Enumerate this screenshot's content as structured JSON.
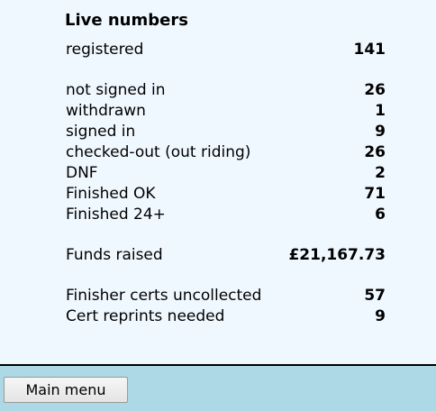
{
  "live": {
    "title": "Live numbers",
    "registered": {
      "label": "registered",
      "value": "141"
    },
    "not_signed_in": {
      "label": "not signed in",
      "value": "26"
    },
    "withdrawn": {
      "label": "withdrawn",
      "value": "1"
    },
    "signed_in": {
      "label": "signed in",
      "value": "9"
    },
    "checked_out": {
      "label": "checked-out (out riding)",
      "value": "26"
    },
    "dnf": {
      "label": "DNF",
      "value": "2"
    },
    "finished_ok": {
      "label": "Finished OK",
      "value": "71"
    },
    "finished_24": {
      "label": "Finished 24+",
      "value": "6"
    },
    "funds": {
      "label": "Funds raised",
      "value": "£21,167.73"
    },
    "certs_uncollected": {
      "label": "Finisher certs uncollected",
      "value": "57"
    },
    "cert_reprints": {
      "label": "Cert reprints needed",
      "value": "9"
    }
  },
  "footer": {
    "main_menu_label": "Main menu"
  },
  "colors": {
    "panel_bg": "#f0f8ff",
    "footer_bg": "#add8e6"
  }
}
